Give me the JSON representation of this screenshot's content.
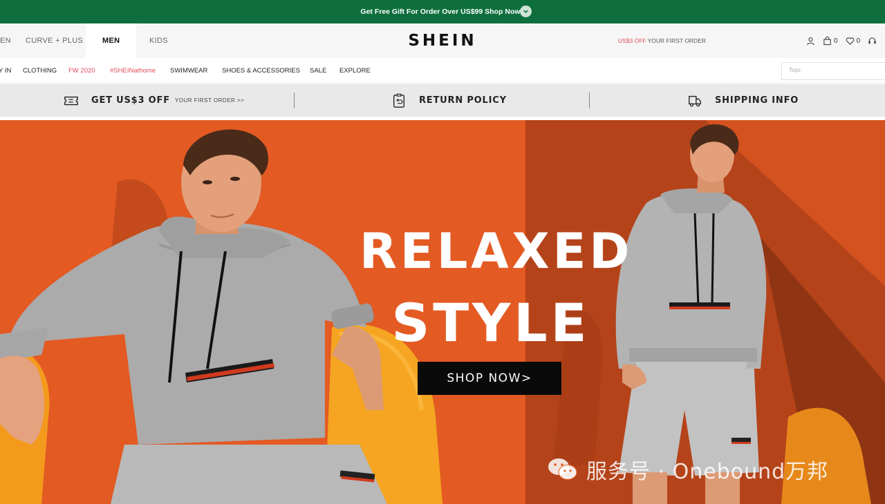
{
  "promo": {
    "text": "Get Free Gift For Order Over US$99 Shop Now>"
  },
  "header": {
    "genders": [
      "EN",
      "CURVE + PLUS",
      "MEN",
      "KIDS"
    ],
    "active_gender": "MEN",
    "logo": "SHEIN",
    "offer_red": "US$3 OFF",
    "offer_rest": "YOUR FIRST ORDER",
    "bag_count": "0",
    "wishlist_count": "0"
  },
  "nav": {
    "items": [
      "Y IN",
      "CLOTHING",
      "FW 2020",
      "#SHEINathome",
      "SWIMWEAR",
      "SHOES & ACCESSORIES",
      "SALE",
      "EXPLORE"
    ],
    "highlight_color": "#e04c5a",
    "search_placeholder": "Tops"
  },
  "info_strip": {
    "coupon_big": "GET US$3 OFF",
    "coupon_small": "YOUR FIRST ORDER >>",
    "return_policy": "RETURN POLICY",
    "shipping_info": "SHIPPING INFO"
  },
  "hero": {
    "headline_line1": "RELAXED",
    "headline_line2": "STYLE",
    "cta": "SHOP NOW>",
    "background_color": "#e35a23"
  },
  "watermark": {
    "text": "服务号 · Onebound万邦"
  },
  "colors": {
    "promo_bg": "#0e6f3d",
    "accent_red": "#e04c5a"
  }
}
